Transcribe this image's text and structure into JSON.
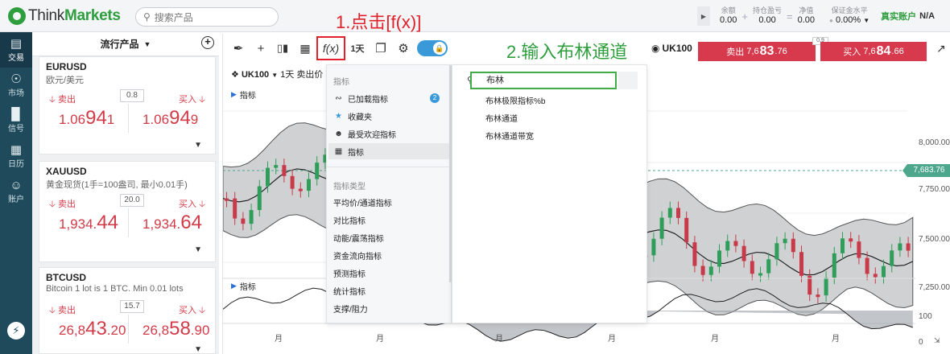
{
  "header": {
    "logo_text_1": "Think",
    "logo_text_2": "Markets",
    "search_placeholder": "搜索产品",
    "balance_label": "余额",
    "balance_value": "0.00",
    "pl_label": "持仓盈亏",
    "pl_value": "0.00",
    "equity_label": "净值",
    "equity_value": "0.00",
    "margin_label": "保证金水平",
    "margin_value": "0.00%",
    "real_account": "真实账户",
    "account_na": "N/A"
  },
  "nav": [
    {
      "label": "交易",
      "icon": "trade-icon"
    },
    {
      "label": "市场",
      "icon": "globe-icon"
    },
    {
      "label": "信号",
      "icon": "signal-icon"
    },
    {
      "label": "日历",
      "icon": "calendar-icon"
    },
    {
      "label": "账户",
      "icon": "account-icon"
    }
  ],
  "watchlist": {
    "title": "流行产品",
    "sell_label": "卖出",
    "buy_label": "买入",
    "items": [
      {
        "symbol": "EURUSD",
        "desc": "欧元/美元",
        "spread": "0.8",
        "sell_pre": "1.06",
        "sell_big": "94",
        "sell_post": "1",
        "buy_pre": "1.06",
        "buy_big": "94",
        "buy_post": "9"
      },
      {
        "symbol": "XAUUSD",
        "desc": "黄金现货(1手=100盎司, 最小0.01手)",
        "spread": "20.0",
        "sell_pre": "1,934.",
        "sell_big": "44",
        "sell_post": "",
        "buy_pre": "1,934.",
        "buy_big": "64",
        "buy_post": ""
      },
      {
        "symbol": "BTCUSD",
        "desc": "Bitcoin 1 lot is 1 BTC. Min 0.01 lots",
        "spread": "15.7",
        "sell_pre": "26,8",
        "sell_big": "43",
        "sell_post": ".20",
        "buy_pre": "26,8",
        "buy_big": "58",
        "buy_post": ".90"
      }
    ]
  },
  "toolbar": {
    "fx_label": "f(x)",
    "timeframe": "1天",
    "symbol": "UK100",
    "sell_label": "卖出",
    "sell_pre": "7,6",
    "sell_big": "83",
    "sell_post": ".76",
    "buy_label": "买入",
    "buy_pre": "7,6",
    "buy_big": "84",
    "buy_post": ".66",
    "spread": "0.9"
  },
  "annotations": {
    "step1": "1.点击[f(x)]",
    "step2": "2.输入布林通道"
  },
  "chart": {
    "info_symbol": "UK100",
    "info_tf": "1天",
    "info_side": "卖出价",
    "indicator_label": "指标",
    "y_ticks": [
      "8,000.00",
      "7,750.00",
      "7,500.00",
      "7,250.00"
    ],
    "osc_ticks": [
      "100",
      "0"
    ],
    "x_ticks": [
      "月",
      "月",
      "月",
      "月",
      "月",
      "月"
    ],
    "current_price": "7,683.76"
  },
  "menu": {
    "head1": "指标",
    "loaded": "已加载指标",
    "loaded_count": "2",
    "favorites": "收藏夹",
    "popular": "最受欢迎指标",
    "indicators": "指标",
    "head2": "指标类型",
    "types": [
      "平均价/通道指标",
      "对比指标",
      "动能/震荡指标",
      "资金流向指标",
      "预测指标",
      "统计指标",
      "支撑/阻力"
    ],
    "search_value": "布林",
    "results": [
      "布林极限指标%b",
      "布林通道",
      "布林通道带宽"
    ]
  },
  "colors": {
    "brand_green": "#2e9e3e",
    "sell_red": "#d63a4c",
    "step1_red": "#e0212b",
    "step2_green": "#2e9e3e",
    "nav_bg": "#1f4a5b"
  }
}
